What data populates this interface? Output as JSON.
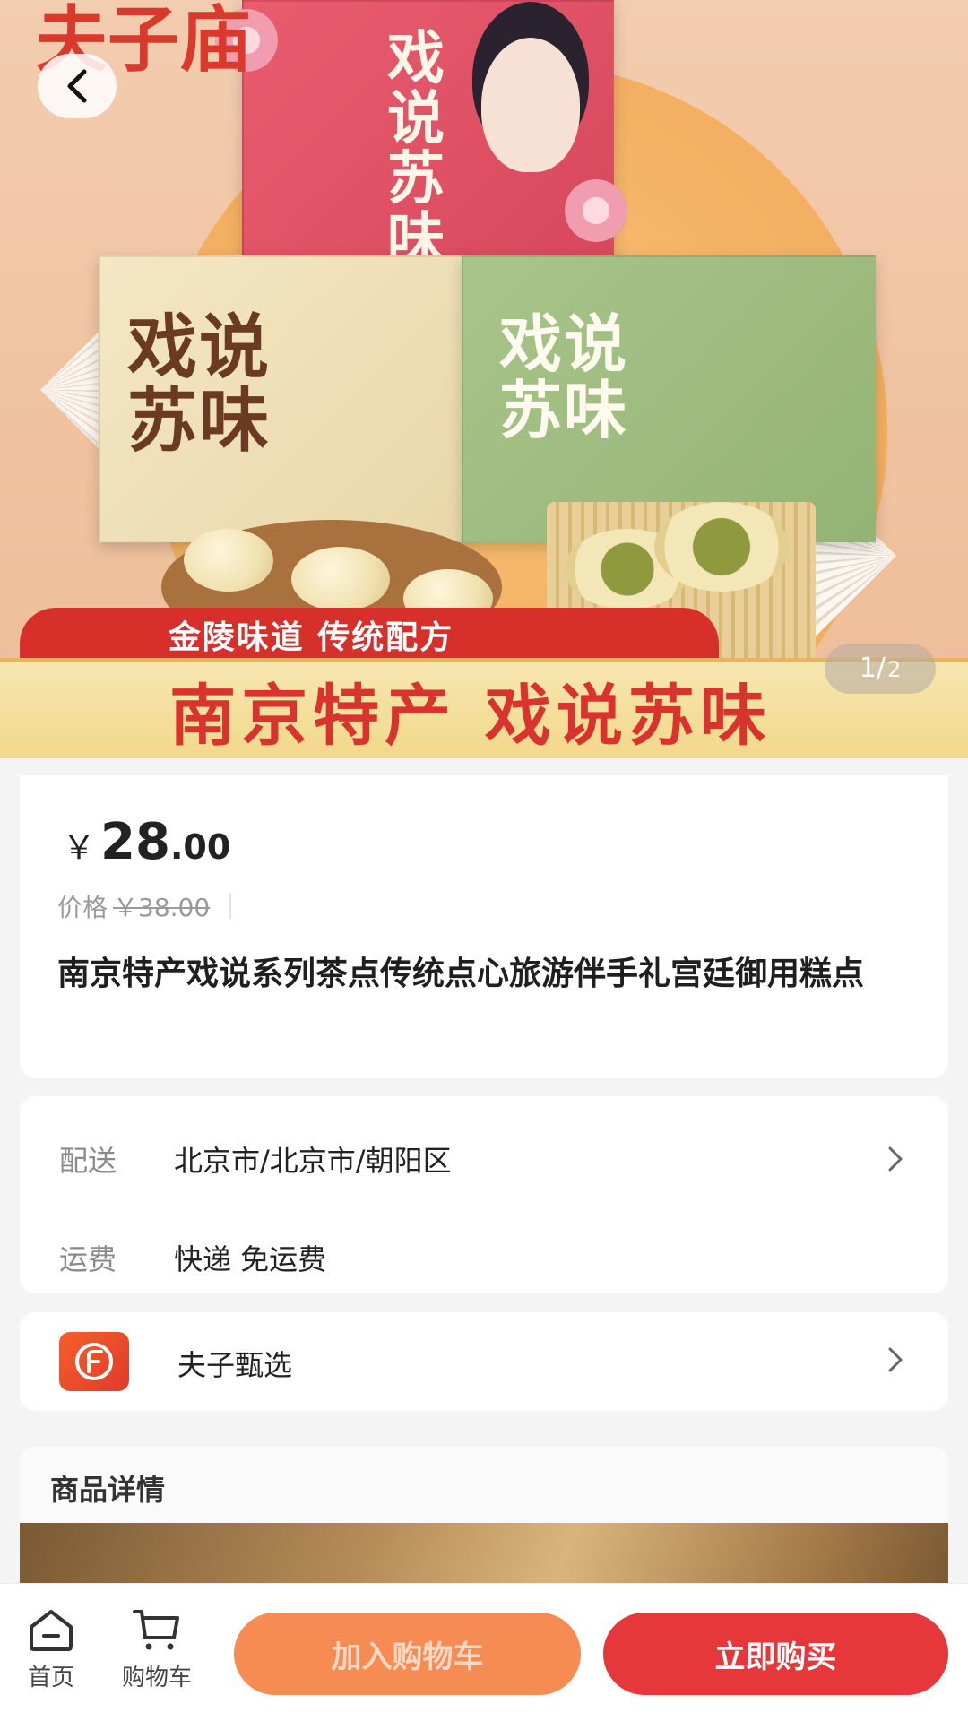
{
  "hero": {
    "banner_sub": "金陵味道 传统配方",
    "banner_main": "南京特产 戏说苏味",
    "box_title": "戏说苏味",
    "pager_current": "1/",
    "pager_total": "2"
  },
  "price": {
    "currency": "￥",
    "integer": "28",
    "decimal": ".00",
    "orig_label": "价格",
    "orig_value": "￥38.00"
  },
  "product": {
    "title": "南京特产戏说系列茶点传统点心旅游伴手礼宫廷御用糕点"
  },
  "delivery": {
    "ship_label": "配送",
    "ship_value": "北京市/北京市/朝阳区",
    "fee_label": "运费",
    "fee_value": "快递 免运费"
  },
  "shop": {
    "name": "夫子甄选"
  },
  "details": {
    "title": "商品详情"
  },
  "bottom": {
    "home_label": "首页",
    "cart_label": "购物车",
    "add_cart": "加入购物车",
    "buy_now": "立即购买"
  },
  "colors": {
    "accent": "#e6373a",
    "secondary": "#f68b54",
    "banner_red": "#d72f2a",
    "banner_gold": "#f1d889"
  },
  "icons": [
    "back-arrow-icon",
    "chevron-right-icon",
    "home-icon",
    "cart-icon",
    "shop-logo-icon"
  ]
}
